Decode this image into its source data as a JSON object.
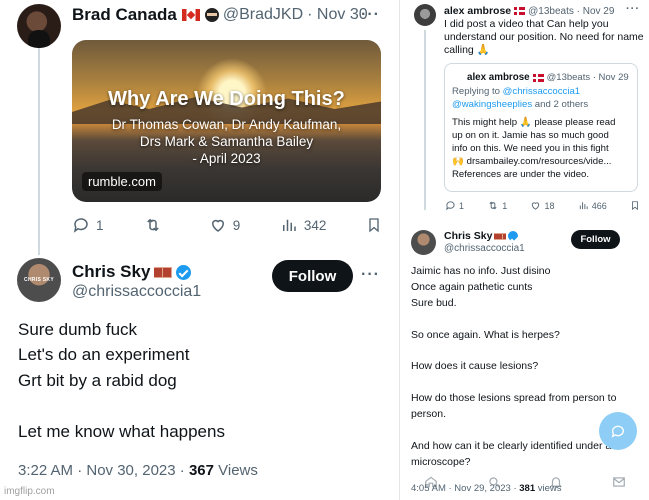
{
  "left": {
    "tweet1": {
      "name": "Brad Canada",
      "handle": "@BradJKD",
      "date": "· Nov 30",
      "more": "···",
      "card": {
        "title": "Why Are We Doing This?",
        "subtitle_lines": [
          "Dr Thomas Cowan, Dr Andy Kaufman,",
          "Drs Mark & Samantha Bailey",
          "- April 2023"
        ],
        "source": "rumble.com"
      },
      "actions": {
        "replies": "1",
        "reposts": "",
        "likes": "9",
        "views": "342"
      }
    },
    "tweet2": {
      "name": "Chris Sky",
      "handle": "@chrissaccoccia1",
      "avatar_text": "CHRIS SKY",
      "follow_label": "Follow",
      "more": "···",
      "body_lines": [
        "Sure dumb fuck",
        "Let's do an experiment",
        "Grt bit by a rabid dog",
        "",
        "Let me know what happens"
      ],
      "time": "3:22 AM · Nov 30, 2023 · ",
      "views_count": "367",
      "views_label": " Views"
    },
    "watermark": "imgflip.com"
  },
  "right": {
    "tweet1": {
      "name": "alex ambrose",
      "handle": "@13beats · Nov 29",
      "more": "···",
      "text_lines": [
        "I did post a video that Can help you",
        "understand our position. No need for name",
        "calling 🙏"
      ],
      "quote": {
        "name": "alex ambrose",
        "handle": "@13beats · Nov 29",
        "reply_prefix": "Replying to ",
        "reply_mention": "@chrissaccoccia1",
        "reply_line2_mention": "@wakingsheeplies",
        "reply_line2_suffix": " and 2 others",
        "lines": [
          "This might help 🙏 please please read",
          "up on on it. Jamie has so much good",
          "info on this. We need you in this fight",
          "🙌 drsambailey.com/resources/vide...",
          "References are under the video."
        ]
      },
      "actions": {
        "replies": "1",
        "reposts": "1",
        "likes": "18",
        "views": "466"
      }
    },
    "tweet2": {
      "name": "Chris Sky",
      "handle": "@chrissaccoccia1",
      "follow_label": "Follow",
      "body_lines": [
        "Jaimic has  no info. Just disino",
        "Once again pathetic cunts",
        "Sure bud.",
        "",
        "So once again. What is herpes?",
        "",
        "How does it cause lesions?",
        "",
        "How do those lesions spread from person to",
        "person.",
        "",
        "And how can it be clearly identified under a",
        "microscope?"
      ],
      "time": "4:05 AM · Nov 29, 2023 · ",
      "views_count": "381",
      "views_label": " views"
    }
  },
  "colors": {
    "accent": "#1d9bf0",
    "text": "#0f1419",
    "muted": "#536471",
    "button": "#0f1419"
  }
}
